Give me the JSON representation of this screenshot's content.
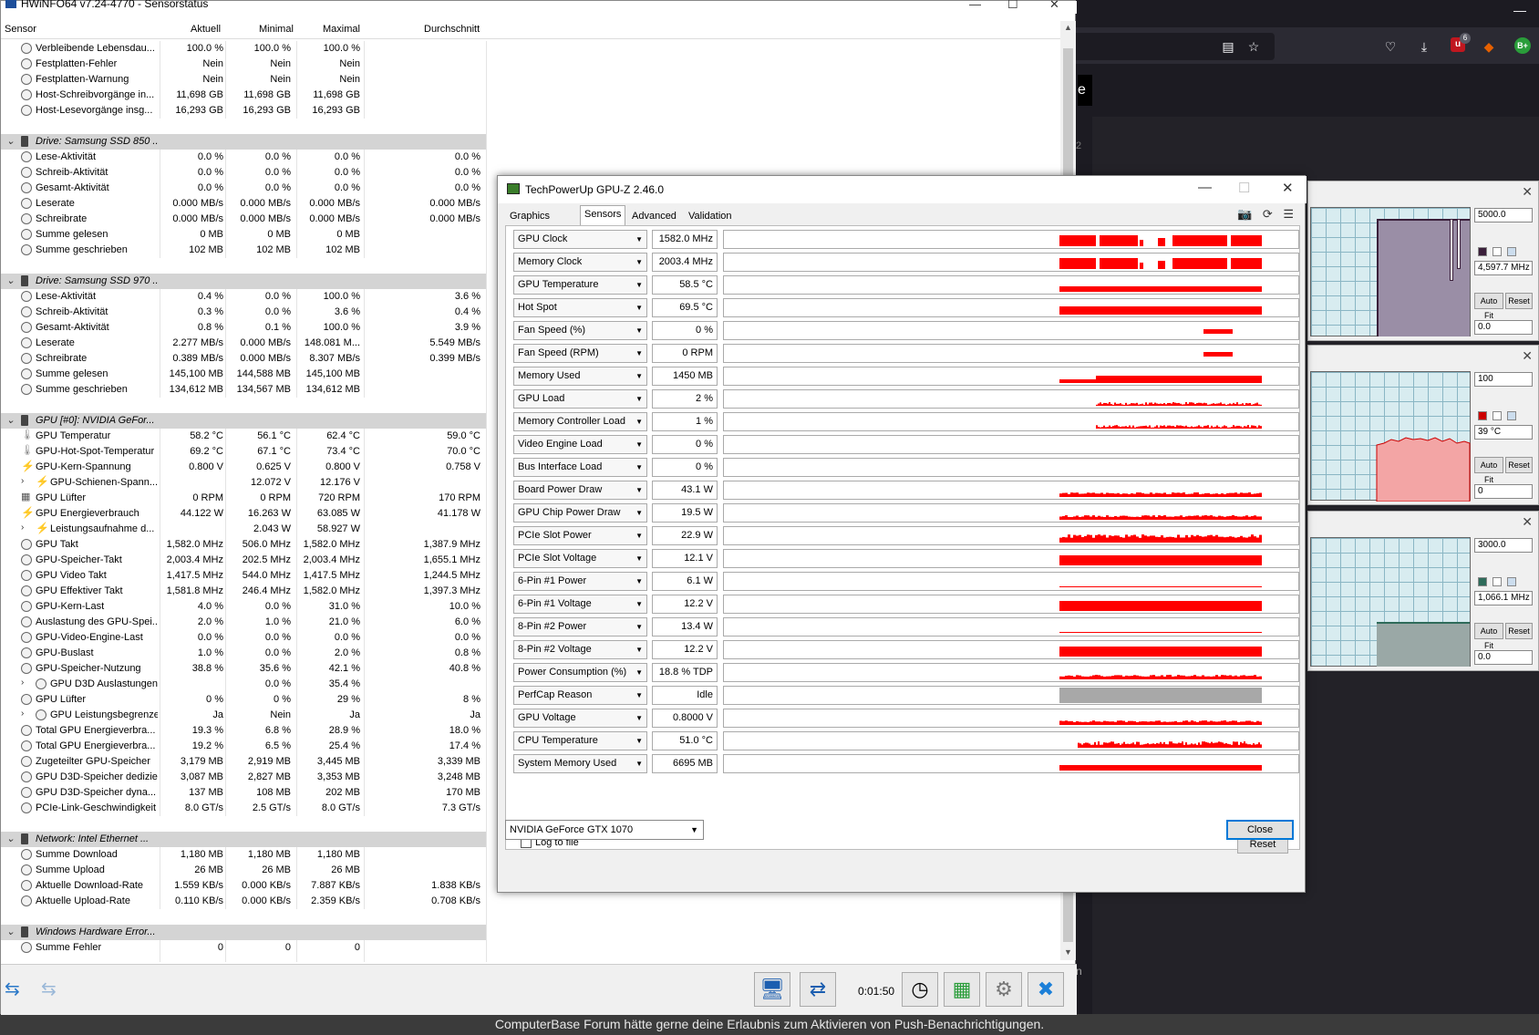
{
  "browser": {
    "minimize_glyph": "—",
    "reader_icon": "▤",
    "bookmark_icon": "☆",
    "pocket_icon": "♡",
    "download_icon": "⤓",
    "ext_badge_text": "u",
    "ext_badge_count": "6",
    "fox_icon": "◆",
    "avatar_text": "B+",
    "side_letter": "e",
    "side_digit": "2",
    "bottom_letter": "n"
  },
  "notification": "ComputerBase Forum hätte gerne deine Erlaubnis zum Aktivieren von Push-Benachrichtigungen.",
  "monitors": [
    {
      "top_value": "5000.0",
      "mid_value": "4,597.7 MHz",
      "bottom_value": "0.0",
      "autofit": "Auto Fit",
      "reset": "Reset",
      "swatch": "#3a1f3a"
    },
    {
      "top_value": "100",
      "mid_value": "39 °C",
      "bottom_value": "0",
      "autofit": "Auto Fit",
      "reset": "Reset",
      "swatch": "#cc0000"
    },
    {
      "top_value": "3000.0",
      "mid_value": "1,066.1 MHz",
      "bottom_value": "0.0",
      "autofit": "Auto Fit",
      "reset": "Reset",
      "swatch": "#2e6b5a"
    }
  ],
  "hwinfo": {
    "title": "HWiNFO64 v7.24-4770 - Sensorstatus",
    "columns": {
      "sensor": "Sensor",
      "current": "Aktuell",
      "min": "Minimal",
      "max": "Maximal",
      "avg": "Durchschnitt"
    },
    "elapsed": "0:01:50",
    "rows": [
      {
        "t": "r",
        "n": "Verbleibende Lebensdau...",
        "a": "100.0 %",
        "b": "100.0 %",
        "c": "100.0 %",
        "d": ""
      },
      {
        "t": "r",
        "n": "Festplatten-Fehler",
        "a": "Nein",
        "b": "Nein",
        "c": "Nein",
        "d": ""
      },
      {
        "t": "r",
        "n": "Festplatten-Warnung",
        "a": "Nein",
        "b": "Nein",
        "c": "Nein",
        "d": ""
      },
      {
        "t": "r",
        "n": "Host-Schreibvorgänge in...",
        "a": "11,698 GB",
        "b": "11,698 GB",
        "c": "11,698 GB",
        "d": ""
      },
      {
        "t": "r",
        "n": "Host-Lesevorgänge insg...",
        "a": "16,293 GB",
        "b": "16,293 GB",
        "c": "16,293 GB",
        "d": ""
      },
      {
        "t": "blank"
      },
      {
        "t": "g",
        "n": "Drive: Samsung SSD 850 ..."
      },
      {
        "t": "r",
        "n": "Lese-Aktivität",
        "a": "0.0 %",
        "b": "0.0 %",
        "c": "0.0 %",
        "d": "0.0 %"
      },
      {
        "t": "r",
        "n": "Schreib-Aktivität",
        "a": "0.0 %",
        "b": "0.0 %",
        "c": "0.0 %",
        "d": "0.0 %"
      },
      {
        "t": "r",
        "n": "Gesamt-Aktivität",
        "a": "0.0 %",
        "b": "0.0 %",
        "c": "0.0 %",
        "d": "0.0 %"
      },
      {
        "t": "r",
        "n": "Leserate",
        "a": "0.000 MB/s",
        "b": "0.000 MB/s",
        "c": "0.000 MB/s",
        "d": "0.000 MB/s"
      },
      {
        "t": "r",
        "n": "Schreibrate",
        "a": "0.000 MB/s",
        "b": "0.000 MB/s",
        "c": "0.000 MB/s",
        "d": "0.000 MB/s"
      },
      {
        "t": "r",
        "n": "Summe gelesen",
        "a": "0 MB",
        "b": "0 MB",
        "c": "0 MB",
        "d": ""
      },
      {
        "t": "r",
        "n": "Summe geschrieben",
        "a": "102 MB",
        "b": "102 MB",
        "c": "102 MB",
        "d": ""
      },
      {
        "t": "blank"
      },
      {
        "t": "g",
        "n": "Drive: Samsung SSD 970 ..."
      },
      {
        "t": "r",
        "n": "Lese-Aktivität",
        "a": "0.4 %",
        "b": "0.0 %",
        "c": "100.0 %",
        "d": "3.6 %"
      },
      {
        "t": "r",
        "n": "Schreib-Aktivität",
        "a": "0.3 %",
        "b": "0.0 %",
        "c": "3.6 %",
        "d": "0.4 %"
      },
      {
        "t": "r",
        "n": "Gesamt-Aktivität",
        "a": "0.8 %",
        "b": "0.1 %",
        "c": "100.0 %",
        "d": "3.9 %"
      },
      {
        "t": "r",
        "n": "Leserate",
        "a": "2.277 MB/s",
        "b": "0.000 MB/s",
        "c": "148.081 M...",
        "d": "5.549 MB/s"
      },
      {
        "t": "r",
        "n": "Schreibrate",
        "a": "0.389 MB/s",
        "b": "0.000 MB/s",
        "c": "8.307 MB/s",
        "d": "0.399 MB/s"
      },
      {
        "t": "r",
        "n": "Summe gelesen",
        "a": "145,100 MB",
        "b": "144,588 MB",
        "c": "145,100 MB",
        "d": ""
      },
      {
        "t": "r",
        "n": "Summe geschrieben",
        "a": "134,612 MB",
        "b": "134,567 MB",
        "c": "134,612 MB",
        "d": ""
      },
      {
        "t": "blank"
      },
      {
        "t": "g",
        "n": "GPU [#0]: NVIDIA GeFor..."
      },
      {
        "t": "r",
        "i": "therm",
        "n": "GPU Temperatur",
        "a": "58.2 °C",
        "b": "56.1 °C",
        "c": "62.4 °C",
        "d": "59.0 °C"
      },
      {
        "t": "r",
        "i": "therm",
        "n": "GPU-Hot-Spot-Temperatur",
        "a": "69.2 °C",
        "b": "67.1 °C",
        "c": "73.4 °C",
        "d": "70.0 °C"
      },
      {
        "t": "r",
        "i": "bolt",
        "n": "GPU-Kern-Spannung",
        "a": "0.800 V",
        "b": "0.625 V",
        "c": "0.800 V",
        "d": "0.758 V"
      },
      {
        "t": "s",
        "i": "bolt",
        "n": "GPU-Schienen-Spann...",
        "a": "",
        "b": "12.072 V",
        "c": "12.176 V",
        "d": ""
      },
      {
        "t": "r",
        "i": "fan",
        "n": "GPU Lüfter",
        "a": "0 RPM",
        "b": "0 RPM",
        "c": "720 RPM",
        "d": "170 RPM"
      },
      {
        "t": "r",
        "i": "bolt",
        "n": "GPU Energieverbrauch",
        "a": "44.122 W",
        "b": "16.263 W",
        "c": "63.085 W",
        "d": "41.178 W"
      },
      {
        "t": "s",
        "i": "bolt",
        "n": "Leistungsaufnahme d...",
        "a": "",
        "b": "2.043 W",
        "c": "58.927 W",
        "d": ""
      },
      {
        "t": "r",
        "n": "GPU Takt",
        "a": "1,582.0 MHz",
        "b": "506.0 MHz",
        "c": "1,582.0 MHz",
        "d": "1,387.9 MHz"
      },
      {
        "t": "r",
        "n": "GPU-Speicher-Takt",
        "a": "2,003.4 MHz",
        "b": "202.5 MHz",
        "c": "2,003.4 MHz",
        "d": "1,655.1 MHz"
      },
      {
        "t": "r",
        "n": "GPU Video Takt",
        "a": "1,417.5 MHz",
        "b": "544.0 MHz",
        "c": "1,417.5 MHz",
        "d": "1,244.5 MHz"
      },
      {
        "t": "r",
        "n": "GPU Effektiver Takt",
        "a": "1,581.8 MHz",
        "b": "246.4 MHz",
        "c": "1,582.0 MHz",
        "d": "1,397.3 MHz"
      },
      {
        "t": "r",
        "n": "GPU-Kern-Last",
        "a": "4.0 %",
        "b": "0.0 %",
        "c": "31.0 %",
        "d": "10.0 %"
      },
      {
        "t": "r",
        "n": "Auslastung des GPU-Spei...",
        "a": "2.0 %",
        "b": "1.0 %",
        "c": "21.0 %",
        "d": "6.0 %"
      },
      {
        "t": "r",
        "n": "GPU-Video-Engine-Last",
        "a": "0.0 %",
        "b": "0.0 %",
        "c": "0.0 %",
        "d": "0.0 %"
      },
      {
        "t": "r",
        "n": "GPU-Buslast",
        "a": "1.0 %",
        "b": "0.0 %",
        "c": "2.0 %",
        "d": "0.8 %"
      },
      {
        "t": "r",
        "n": "GPU-Speicher-Nutzung",
        "a": "38.8 %",
        "b": "35.6 %",
        "c": "42.1 %",
        "d": "40.8 %"
      },
      {
        "t": "s",
        "n": "GPU D3D Auslastungen",
        "a": "",
        "b": "0.0 %",
        "c": "35.4 %",
        "d": ""
      },
      {
        "t": "r",
        "n": "GPU Lüfter",
        "a": "0 %",
        "b": "0 %",
        "c": "29 %",
        "d": "8 %"
      },
      {
        "t": "s",
        "n": "GPU Leistungsbegrenzer",
        "a": "Ja",
        "b": "Nein",
        "c": "Ja",
        "d": "Ja"
      },
      {
        "t": "r",
        "n": "Total GPU Energieverbra...",
        "a": "19.3 %",
        "b": "6.8 %",
        "c": "28.9 %",
        "d": "18.0 %"
      },
      {
        "t": "r",
        "n": "Total GPU Energieverbra...",
        "a": "19.2 %",
        "b": "6.5 %",
        "c": "25.4 %",
        "d": "17.4 %"
      },
      {
        "t": "r",
        "n": "Zugeteilter GPU-Speicher",
        "a": "3,179 MB",
        "b": "2,919 MB",
        "c": "3,445 MB",
        "d": "3,339 MB"
      },
      {
        "t": "r",
        "n": "GPU D3D-Speicher dediziert",
        "a": "3,087 MB",
        "b": "2,827 MB",
        "c": "3,353 MB",
        "d": "3,248 MB"
      },
      {
        "t": "r",
        "n": "GPU D3D-Speicher dyna...",
        "a": "137 MB",
        "b": "108 MB",
        "c": "202 MB",
        "d": "170 MB"
      },
      {
        "t": "r",
        "n": "PCIe-Link-Geschwindigkeit",
        "a": "8.0 GT/s",
        "b": "2.5 GT/s",
        "c": "8.0 GT/s",
        "d": "7.3 GT/s"
      },
      {
        "t": "blank"
      },
      {
        "t": "g",
        "n": "Network: Intel Ethernet ..."
      },
      {
        "t": "r",
        "n": "Summe Download",
        "a": "1,180 MB",
        "b": "1,180 MB",
        "c": "1,180 MB",
        "d": ""
      },
      {
        "t": "r",
        "n": "Summe Upload",
        "a": "26 MB",
        "b": "26 MB",
        "c": "26 MB",
        "d": ""
      },
      {
        "t": "r",
        "n": "Aktuelle Download-Rate",
        "a": "1.559 KB/s",
        "b": "0.000 KB/s",
        "c": "7.887 KB/s",
        "d": "1.838 KB/s"
      },
      {
        "t": "r",
        "n": "Aktuelle Upload-Rate",
        "a": "0.110 KB/s",
        "b": "0.000 KB/s",
        "c": "2.359 KB/s",
        "d": "0.708 KB/s"
      },
      {
        "t": "blank"
      },
      {
        "t": "g",
        "n": "Windows Hardware Error..."
      },
      {
        "t": "r",
        "n": "Summe Fehler",
        "a": "0",
        "b": "0",
        "c": "0",
        "d": ""
      }
    ]
  },
  "gpuz": {
    "title": "TechPowerUp GPU-Z 2.46.0",
    "tabs": [
      "Graphics Card",
      "Sensors",
      "Advanced",
      "Validation"
    ],
    "active_tab": 1,
    "log_label": "Log to file",
    "reset_label": "Reset",
    "close_label": "Close",
    "gpu_name": "NVIDIA GeForce GTX 1070",
    "sensors": [
      {
        "label": "GPU Clock",
        "value": "1582.0 MHz",
        "g": "steps"
      },
      {
        "label": "Memory Clock",
        "value": "2003.4 MHz",
        "g": "steps"
      },
      {
        "label": "GPU Temperature",
        "value": "58.5 °C",
        "g": "band"
      },
      {
        "label": "Hot Spot",
        "value": "69.5 °C",
        "g": "bandhi"
      },
      {
        "label": "Fan Speed (%)",
        "value": "0 %",
        "g": "fan"
      },
      {
        "label": "Fan Speed (RPM)",
        "value": "0 RPM",
        "g": "fan"
      },
      {
        "label": "Memory Used",
        "value": "1450 MB",
        "g": "mem"
      },
      {
        "label": "GPU Load",
        "value": "2 %",
        "g": "noise"
      },
      {
        "label": "Memory Controller Load",
        "value": "1 %",
        "g": "noise"
      },
      {
        "label": "Video Engine Load",
        "value": "0 %",
        "g": "none"
      },
      {
        "label": "Bus Interface Load",
        "value": "0 %",
        "g": "none"
      },
      {
        "label": "Board Power Draw",
        "value": "43.1 W",
        "g": "low"
      },
      {
        "label": "GPU Chip Power Draw",
        "value": "19.5 W",
        "g": "low"
      },
      {
        "label": "PCIe Slot Power",
        "value": "22.9 W",
        "g": "mid"
      },
      {
        "label": "PCIe Slot Voltage",
        "value": "12.1 V",
        "g": "full"
      },
      {
        "label": "6-Pin #1 Power",
        "value": "6.1 W",
        "g": "thin"
      },
      {
        "label": "6-Pin #1 Voltage",
        "value": "12.2 V",
        "g": "full"
      },
      {
        "label": "8-Pin #2 Power",
        "value": "13.4 W",
        "g": "thin"
      },
      {
        "label": "8-Pin #2 Voltage",
        "value": "12.2 V",
        "g": "full"
      },
      {
        "label": "Power Consumption (%)",
        "value": "18.8 % TDP",
        "g": "low"
      },
      {
        "label": "PerfCap Reason",
        "value": "Idle",
        "g": "gray"
      },
      {
        "label": "GPU Voltage",
        "value": "0.8000 V",
        "g": "low"
      },
      {
        "label": "CPU Temperature",
        "value": "51.0 °C",
        "g": "cpu"
      },
      {
        "label": "System Memory Used",
        "value": "6695 MB",
        "g": "band"
      }
    ]
  }
}
